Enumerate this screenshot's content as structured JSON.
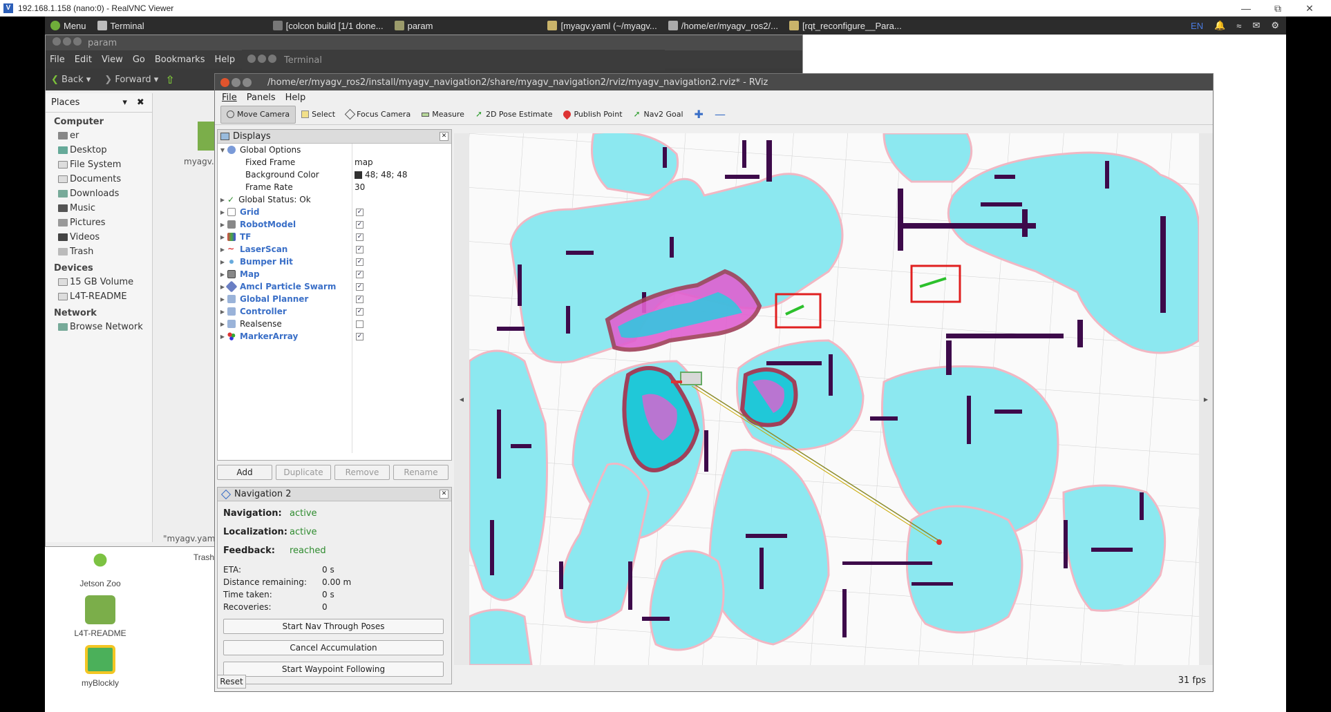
{
  "vnc": {
    "title": "192.168.1.158 (nano:0) - RealVNC Viewer"
  },
  "panel": {
    "menu": "Menu",
    "terminal": "Terminal",
    "tasks": [
      "[colcon build [1/1 done...",
      "param",
      "[myagv.yaml (~/myagv...",
      "/home/er/myagv_ros2/...",
      "[rqt_reconfigure__Para..."
    ],
    "lang": "EN"
  },
  "desktop": {
    "icons": [
      "Jetson Zoo",
      "L4T-README",
      "myBlockly"
    ],
    "trash": "Trash"
  },
  "filemanager": {
    "title": "param",
    "menu": [
      "File",
      "Edit",
      "View",
      "Go",
      "Bookmarks",
      "Help"
    ],
    "back": "Back",
    "forward": "Forward",
    "places": "Places",
    "sections": {
      "computer": "Computer",
      "devices": "Devices",
      "network": "Network"
    },
    "computer_items": [
      "er",
      "Desktop",
      "File System",
      "Documents",
      "Downloads",
      "Music",
      "Pictures",
      "Videos",
      "Trash"
    ],
    "device_items": [
      "15 GB Volume",
      "L4T-README"
    ],
    "network_items": [
      "Browse Network"
    ],
    "file_label": "myagv...",
    "status": "\"myagv.yaml"
  },
  "terminal": {
    "title": "Terminal"
  },
  "rviz": {
    "title": "/home/er/myagv_ros2/install/myagv_navigation2/share/myagv_navigation2/rviz/myagv_navigation2.rviz* - RViz",
    "menu": [
      "File",
      "Panels",
      "Help"
    ],
    "tools": [
      "Move Camera",
      "Select",
      "Focus Camera",
      "Measure",
      "2D Pose Estimate",
      "Publish Point",
      "Nav2 Goal"
    ],
    "displays": {
      "title": "Displays",
      "global": "Global Options",
      "fixed_frame_label": "Fixed Frame",
      "fixed_frame": "map",
      "bg_label": "Background Color",
      "bg": "48; 48; 48",
      "fr_label": "Frame Rate",
      "fr": "30",
      "status": "Global Status: Ok",
      "items": [
        {
          "name": "Grid",
          "checked": true
        },
        {
          "name": "RobotModel",
          "checked": true
        },
        {
          "name": "TF",
          "checked": true
        },
        {
          "name": "LaserScan",
          "checked": true
        },
        {
          "name": "Bumper Hit",
          "checked": true
        },
        {
          "name": "Map",
          "checked": true
        },
        {
          "name": "Amcl Particle Swarm",
          "checked": true
        },
        {
          "name": "Global Planner",
          "checked": true
        },
        {
          "name": "Controller",
          "checked": true
        },
        {
          "name": "Realsense",
          "checked": false
        },
        {
          "name": "MarkerArray",
          "checked": true
        }
      ],
      "buttons": [
        "Add",
        "Duplicate",
        "Remove",
        "Rename"
      ]
    },
    "nav2": {
      "title": "Navigation 2",
      "navigation_label": "Navigation:",
      "navigation": "active",
      "localization_label": "Localization:",
      "localization": "active",
      "feedback_label": "Feedback:",
      "feedback": "reached",
      "eta_label": "ETA:",
      "eta": "0 s",
      "dist_label": "Distance remaining:",
      "dist": "0.00 m",
      "time_label": "Time taken:",
      "time": "0 s",
      "rec_label": "Recoveries:",
      "rec": "0",
      "buttons": [
        "Start Nav Through Poses",
        "Cancel Accumulation",
        "Start Waypoint Following"
      ]
    },
    "reset": "Reset",
    "fps": "31 fps"
  },
  "colors": {
    "rviz_title": "#4a4a4a",
    "obstacle": "#3d0a4a",
    "inflation": "#8ce8f0",
    "highlight": "#e02020",
    "active": "#2e8b2e"
  }
}
